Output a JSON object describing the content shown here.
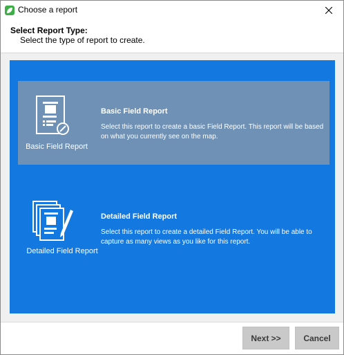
{
  "window": {
    "title": "Choose a report",
    "app_icon": "field-maps-leaf-icon",
    "close_icon": "close-icon"
  },
  "header": {
    "title": "Select Report Type:",
    "subtitle": "Select the type of report to create."
  },
  "options": [
    {
      "caption": "Basic Field Report",
      "title": "Basic Field Report",
      "description": "Select this report to create a basic Field Report. This report will be based on what you currently see on the map.",
      "icon": "basic-report-icon",
      "selected": true
    },
    {
      "caption": "Detailed Field Report",
      "title": "Detailed Field Report",
      "description": "Select this report to create a detailed Field Report. You will be able to capture as many views as you like for this report.",
      "icon": "detailed-report-icon",
      "selected": false
    }
  ],
  "buttons": {
    "next": "Next >>",
    "cancel": "Cancel"
  },
  "colors": {
    "panel_blue": "#1378e0",
    "selected_option": "#6f91b5",
    "button_gray": "#c9c9c9"
  }
}
